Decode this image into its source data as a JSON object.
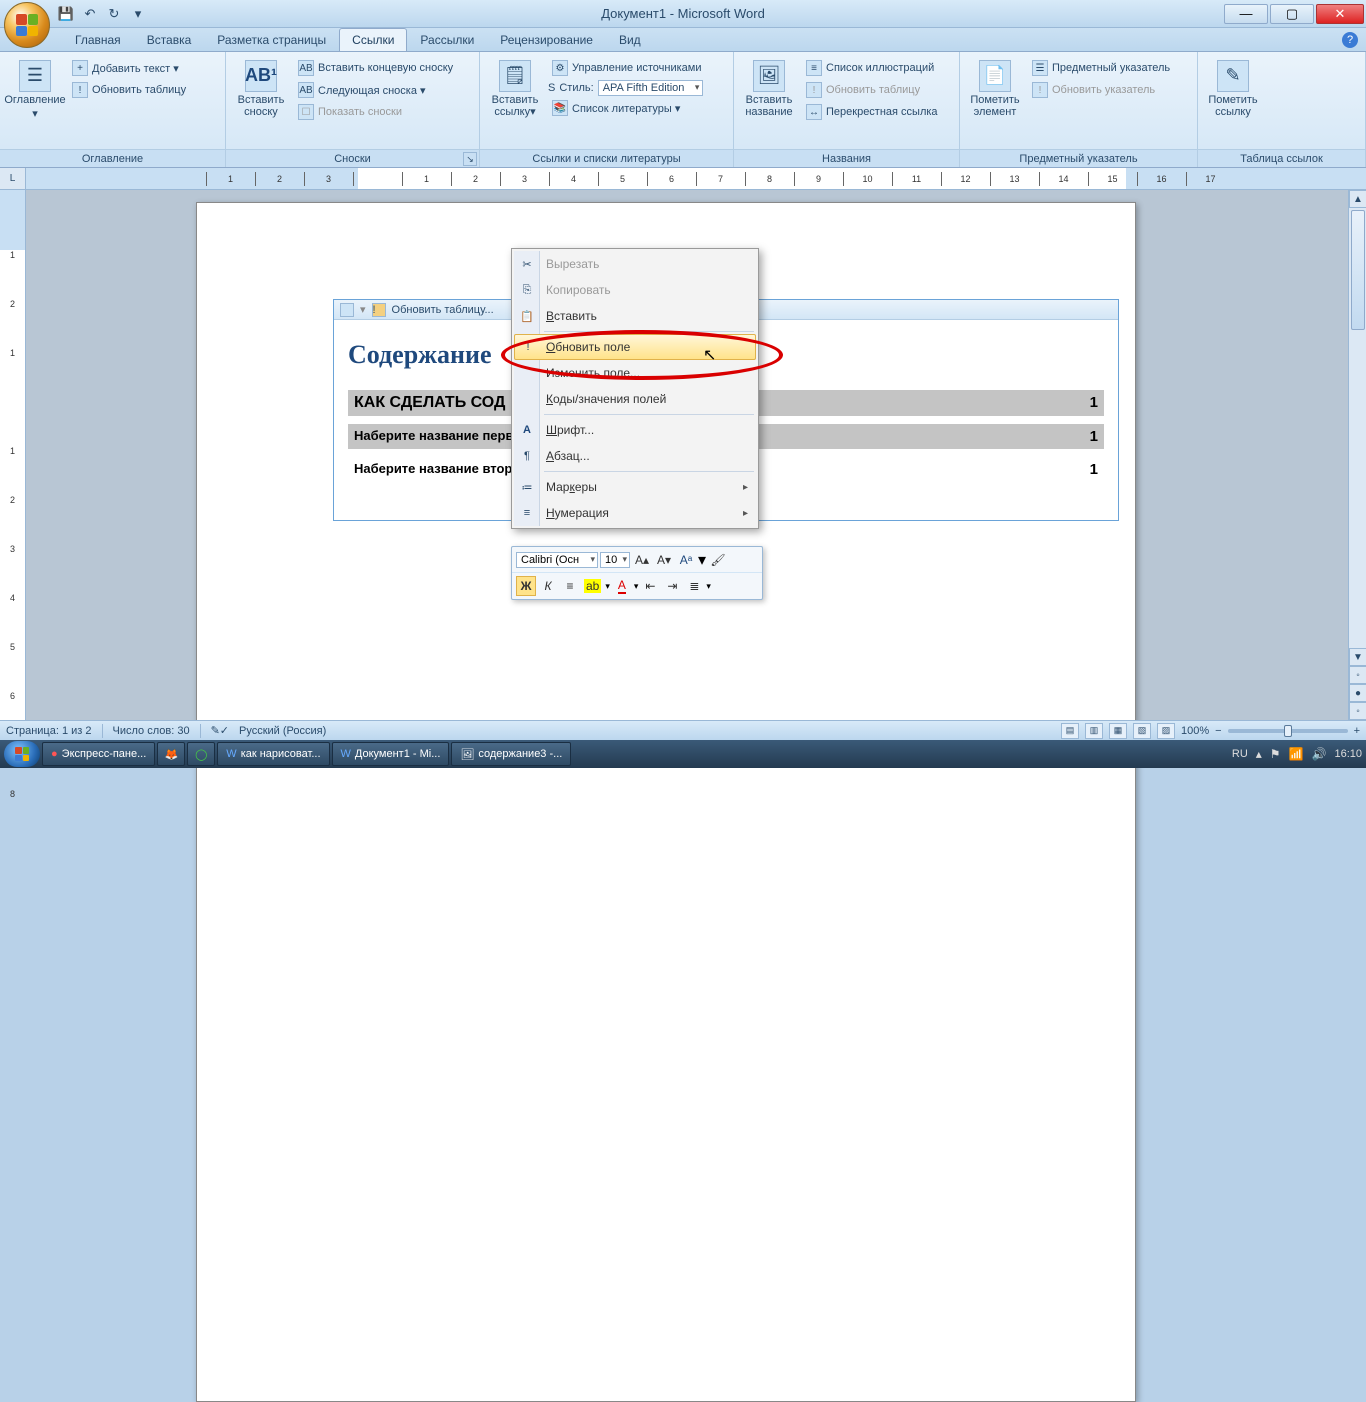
{
  "title": "Документ1 - Microsoft Word",
  "qat": {
    "save": "💾",
    "undo": "↶",
    "redo": "↻",
    "dd": "▾"
  },
  "win": {
    "min": "—",
    "max": "▢",
    "close": "✕"
  },
  "tabs": [
    "Главная",
    "Вставка",
    "Разметка страницы",
    "Ссылки",
    "Рассылки",
    "Рецензирование",
    "Вид"
  ],
  "tabs_active_index": 3,
  "ribbon": {
    "g1": {
      "label": "Оглавление",
      "big": "Оглавление",
      "s1": "Добавить текст ▾",
      "s2": "Обновить таблицу"
    },
    "g2": {
      "label": "Сноски",
      "big": "Вставить сноску",
      "badge": "AB¹",
      "s1": "Вставить концевую сноску",
      "s2": "Следующая сноска ▾",
      "s3": "Показать сноски"
    },
    "g3": {
      "label": "Ссылки и списки литературы",
      "big": "Вставить ссылку▾",
      "s1": "Управление источниками",
      "style_lbl": "Стиль:",
      "style_val": "APA Fifth Edition",
      "s3": "Список литературы ▾"
    },
    "g4": {
      "label": "Названия",
      "big": "Вставить название",
      "s1": "Список иллюстраций",
      "s2": "Обновить таблицу",
      "s3": "Перекрестная ссылка"
    },
    "g5": {
      "label": "Предметный указатель",
      "big": "Пометить элемент",
      "s1": "Предметный указатель",
      "s2": "Обновить указатель"
    },
    "g6": {
      "label": "Таблица ссылок",
      "big": "Пометить ссылку"
    }
  },
  "ruler": {
    "corner": "L",
    "neg": [
      "3",
      "2",
      "1"
    ],
    "nums": [
      "1",
      "2",
      "3",
      "4",
      "5",
      "6",
      "7",
      "8",
      "9",
      "10",
      "11",
      "12",
      "13",
      "14",
      "15",
      "16",
      "17"
    ]
  },
  "vruler": [
    "1",
    "2",
    "1",
    "",
    "1",
    "2",
    "3",
    "4",
    "5",
    "6",
    "7",
    "8"
  ],
  "toc": {
    "head_update": "Обновить таблицу...",
    "title": "Содержание",
    "rows": [
      {
        "l": "КАК СДЕЛАТЬ СОД",
        "r": "1",
        "shade": true,
        "small": false
      },
      {
        "l": "Наберите название перв",
        "r": "1",
        "shade": true,
        "small": true
      },
      {
        "l": "Наберите название второго раздела",
        "r": "1",
        "shade": false,
        "small": true
      }
    ]
  },
  "ctx": {
    "cut": "Вырезать",
    "copy": "Копировать",
    "paste": "Вставить",
    "update_field": "Обновить поле",
    "edit_field": "Изменить поле...",
    "toggle_codes": "Коды/значения полей",
    "font": "Шрифт...",
    "para": "Абзац...",
    "bullets": "Маркеры",
    "numbering": "Нумерация"
  },
  "mini": {
    "font": "Calibri (Осн",
    "size": "10",
    "grow": "A▴",
    "shrink": "A▾",
    "styles": "Aᵃ",
    "painter": "🖌",
    "bold": "Ж",
    "italic": "К",
    "center": "≡",
    "highlight": "ab",
    "fontcolor": "A",
    "dec": "⇤",
    "inc": "⇥",
    "list": "≣"
  },
  "status": {
    "page": "Страница: 1 из 2",
    "words": "Число слов: 30",
    "lang": "Русский (Россия)",
    "zoom": "100%"
  },
  "taskbar": {
    "items": [
      {
        "ico": "O",
        "label": "Экспресс-пане..."
      },
      {
        "ico": "🦊",
        "label": ""
      },
      {
        "ico": "◯",
        "label": ""
      },
      {
        "ico": "W",
        "label": "как нарисоват..."
      },
      {
        "ico": "W",
        "label": "Документ1 - Mi..."
      },
      {
        "ico": "🖼",
        "label": "содержание3 -..."
      }
    ],
    "lang": "RU",
    "clock": "16:10"
  }
}
